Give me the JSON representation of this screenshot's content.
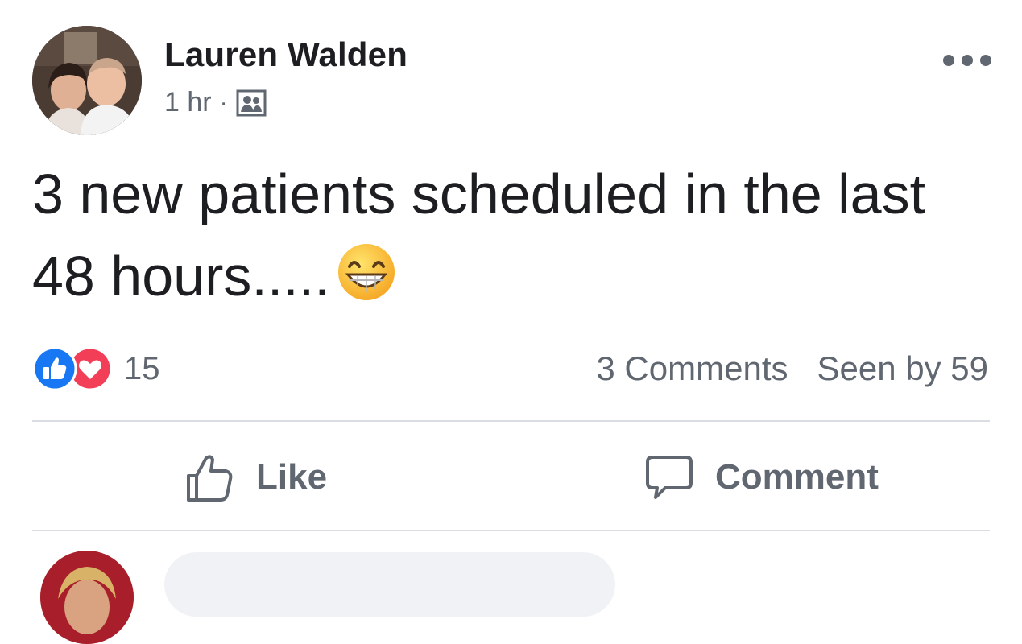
{
  "post": {
    "author": {
      "name": "Lauren Walden"
    },
    "timestamp": "1 hr",
    "separator": "·",
    "audience_icon": "friends-group-icon",
    "text": "3 new patients scheduled in the last 48 hours.....",
    "emoji": "grinning-face-with-smiling-eyes",
    "reactions": {
      "types": [
        "like",
        "love"
      ],
      "count": "15",
      "colors": {
        "like": "#1877f2",
        "love": "#f33e58"
      }
    },
    "stats": {
      "comments": "3 Comments",
      "seen_by": "Seen by 59"
    },
    "actions": {
      "like_label": "Like",
      "comment_label": "Comment"
    }
  }
}
